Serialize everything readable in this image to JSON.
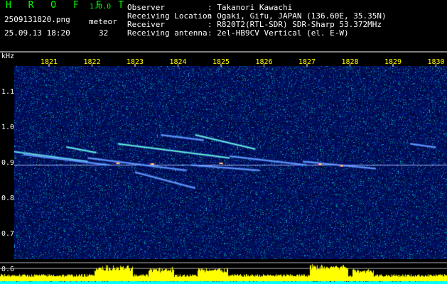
{
  "header": {
    "app_title": "H R O F F T",
    "app_version": "1.0.0",
    "filename": "2509131820.png",
    "datetime": "25.09.13 18:20",
    "meteor_label": "meteor",
    "meteor_count": "32",
    "info": [
      {
        "label": "Observer",
        "value": ": Takanori Kawachi"
      },
      {
        "label": "Receiving Location",
        "value": ": Ogaki, Gifu, JAPAN (136.60E, 35.35N)"
      },
      {
        "label": "Receiver",
        "value": ": R820T2(RTL-SDR) SDR-Sharp 53.372MHz"
      },
      {
        "label": "Receiving antenna",
        "value": ": 2el-HB9CV Vertical (el. E-W)"
      }
    ]
  },
  "axis": {
    "unit": "kHz",
    "x_ticks": [
      "1821",
      "1822",
      "1823",
      "1824",
      "1825",
      "1826",
      "1827",
      "1828",
      "1829",
      "1830"
    ],
    "y_ticks": [
      "1.1",
      "1.0",
      "0.9",
      "0.8",
      "0.7",
      "0.6"
    ]
  },
  "colors": {
    "background": "#000000",
    "noise_low": "#000066",
    "noise_high": "#2233cc",
    "meteor_trace": "#66ffcc",
    "carrier": "#aabbff",
    "tick_text": "#ffff00",
    "signal_fill": "#ffff00",
    "signal_base": "#00ffff",
    "title_color": "#00ff00"
  },
  "spectrogram": {
    "carrier_khz": 0.895,
    "traces": [
      {
        "x0": 1820.05,
        "y0": 0.935,
        "x1": 1821.9,
        "y1": 0.905,
        "strength": 0.9
      },
      {
        "x0": 1820.4,
        "y0": 0.925,
        "x1": 1822.4,
        "y1": 0.895,
        "strength": 0.6
      },
      {
        "x0": 1821.4,
        "y0": 0.946,
        "x1": 1822.1,
        "y1": 0.93,
        "strength": 0.8
      },
      {
        "x0": 1821.9,
        "y0": 0.915,
        "x1": 1824.2,
        "y1": 0.88,
        "strength": 0.7
      },
      {
        "x0": 1822.6,
        "y0": 0.955,
        "x1": 1825.2,
        "y1": 0.915,
        "strength": 0.85
      },
      {
        "x0": 1823.6,
        "y0": 0.98,
        "x1": 1824.6,
        "y1": 0.965,
        "strength": 0.7
      },
      {
        "x0": 1823.0,
        "y0": 0.875,
        "x1": 1824.4,
        "y1": 0.83,
        "strength": 0.75
      },
      {
        "x0": 1824.4,
        "y0": 0.98,
        "x1": 1825.8,
        "y1": 0.94,
        "strength": 0.8
      },
      {
        "x0": 1824.3,
        "y0": 0.895,
        "x1": 1825.9,
        "y1": 0.88,
        "strength": 0.7
      },
      {
        "x0": 1825.2,
        "y0": 0.92,
        "x1": 1827.0,
        "y1": 0.895,
        "strength": 0.6
      },
      {
        "x0": 1826.9,
        "y0": 0.905,
        "x1": 1828.6,
        "y1": 0.885,
        "strength": 0.75
      },
      {
        "x0": 1829.4,
        "y0": 0.955,
        "x1": 1830.0,
        "y1": 0.945,
        "strength": 0.5
      }
    ],
    "hotspots": [
      {
        "x": 1822.6,
        "y": 0.9
      },
      {
        "x": 1823.4,
        "y": 0.898
      },
      {
        "x": 1825.0,
        "y": 0.9
      },
      {
        "x": 1827.3,
        "y": 0.897
      },
      {
        "x": 1827.8,
        "y": 0.893
      }
    ]
  },
  "signal_bursts": [
    {
      "x": 1822.5,
      "w": 0.9,
      "h": 12
    },
    {
      "x": 1823.6,
      "w": 0.6,
      "h": 10
    },
    {
      "x": 1824.8,
      "w": 0.7,
      "h": 9
    },
    {
      "x": 1827.5,
      "w": 0.9,
      "h": 14
    },
    {
      "x": 1828.3,
      "w": 0.5,
      "h": 8
    }
  ]
}
